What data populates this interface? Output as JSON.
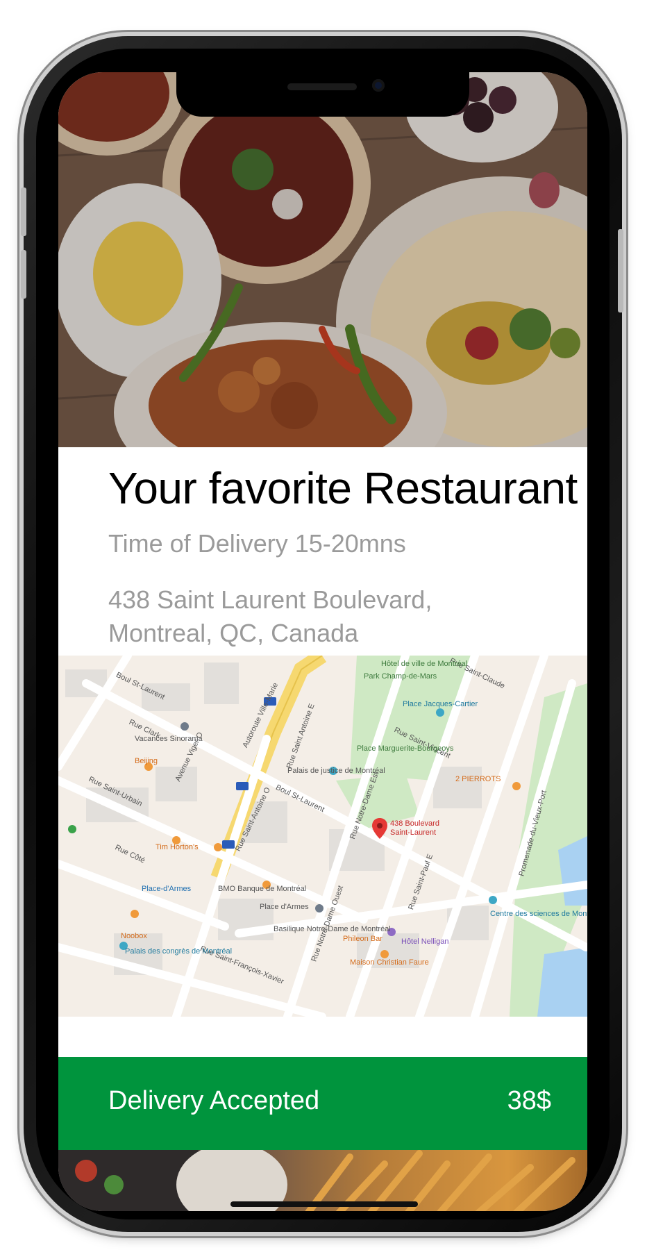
{
  "restaurant": {
    "title": "Your favorite Restaurant",
    "delivery_time": "Time of Delivery 15-20mns",
    "address_line1": "438 Saint Laurent Boulevard,",
    "address_line2": "Montreal, QC, Canada"
  },
  "map": {
    "pin_label_line1": "438 Boulevard",
    "pin_label_line2": "Saint-Laurent",
    "streets": [
      "Boul St-Laurent",
      "Rue Saint-Urbain",
      "Avenue Viger O",
      "Autoroute Ville-Marie",
      "Rue Saint Antoine E",
      "Rue Notre-Dame Est",
      "Rue Notre-Dame Ouest",
      "Rue Saint-Antoine O",
      "Boul St-Laurent",
      "Rue Saint-Vincent",
      "Rue Saint-Claude",
      "Rue Saint-Paul E",
      "Rue Saint-François-Xavier",
      "Rue Clark",
      "Rue Côté",
      "Promenade-du-Vieux-Port"
    ],
    "places": [
      "Hôtel de ville de Montréal",
      "Park Champ-de-Mars",
      "Place Jacques-Cartier",
      "Place Marguerite-Bourgeoys",
      "Palais de justice de Montréal",
      "Vacances Sinorama",
      "Beijing",
      "2 PIERROTS",
      "Tim Horton's",
      "Place-d'Armes",
      "BMO Banque de Montréal",
      "Place d'Armes",
      "Basilique Notre-Dame de Montréal",
      "Phileon Bar",
      "Hôtel Nelligan",
      "Maison Christian Faure",
      "Noobox",
      "Palais des congrès de Montréal",
      "Centre des sciences de Montréal"
    ],
    "highway_shields": [
      "720",
      "720",
      "720"
    ]
  },
  "order": {
    "status_label": "Delivery Accepted",
    "price": "38$"
  },
  "colors": {
    "accent_green": "#00943d",
    "title_text": "#000000",
    "secondary_text": "#9a9a9a"
  }
}
